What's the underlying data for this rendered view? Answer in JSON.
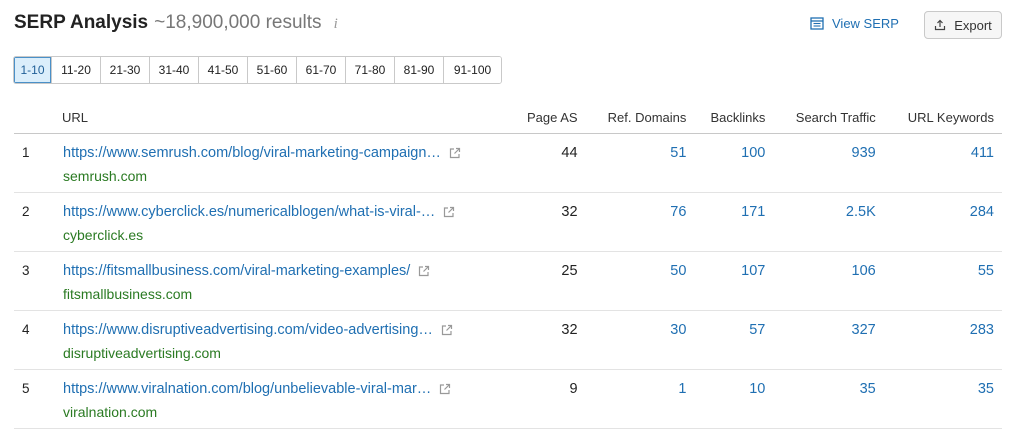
{
  "header": {
    "title": "SERP Analysis",
    "results": "~18,900,000 results",
    "info_glyph": "i",
    "view_serp_label": "View SERP",
    "export_label": "Export"
  },
  "pagination": [
    "1-10",
    "11-20",
    "21-30",
    "31-40",
    "41-50",
    "51-60",
    "61-70",
    "71-80",
    "81-90",
    "91-100"
  ],
  "pagination_active": "1-10",
  "columns": [
    "URL",
    "Page AS",
    "Ref. Domains",
    "Backlinks",
    "Search Traffic",
    "URL Keywords"
  ],
  "rows": [
    {
      "index": "1",
      "url": "https://www.semrush.com/blog/viral-marketing-campaign…",
      "domain": "semrush.com",
      "page_as": "44",
      "ref_domains": "51",
      "backlinks": "100",
      "search_traffic": "939",
      "url_keywords": "411"
    },
    {
      "index": "2",
      "url": "https://www.cyberclick.es/numericalblogen/what-is-viral-…",
      "domain": "cyberclick.es",
      "page_as": "32",
      "ref_domains": "76",
      "backlinks": "171",
      "search_traffic": "2.5K",
      "url_keywords": "284"
    },
    {
      "index": "3",
      "url": "https://fitsmallbusiness.com/viral-marketing-examples/",
      "domain": "fitsmallbusiness.com",
      "page_as": "25",
      "ref_domains": "50",
      "backlinks": "107",
      "search_traffic": "106",
      "url_keywords": "55"
    },
    {
      "index": "4",
      "url": "https://www.disruptiveadvertising.com/video-advertising…",
      "domain": "disruptiveadvertising.com",
      "page_as": "32",
      "ref_domains": "30",
      "backlinks": "57",
      "search_traffic": "327",
      "url_keywords": "283"
    },
    {
      "index": "5",
      "url": "https://www.viralnation.com/blog/unbelievable-viral-mar…",
      "domain": "viralnation.com",
      "page_as": "9",
      "ref_domains": "1",
      "backlinks": "10",
      "search_traffic": "35",
      "url_keywords": "35"
    }
  ],
  "colors": {
    "link": "#1f6fb2",
    "domain": "#2a7a22",
    "active_page_bg": "#dbeefb"
  },
  "icons": {
    "view_serp": "serp-list-icon",
    "export": "upload-icon",
    "external": "external-link-icon",
    "info": "info-icon"
  }
}
